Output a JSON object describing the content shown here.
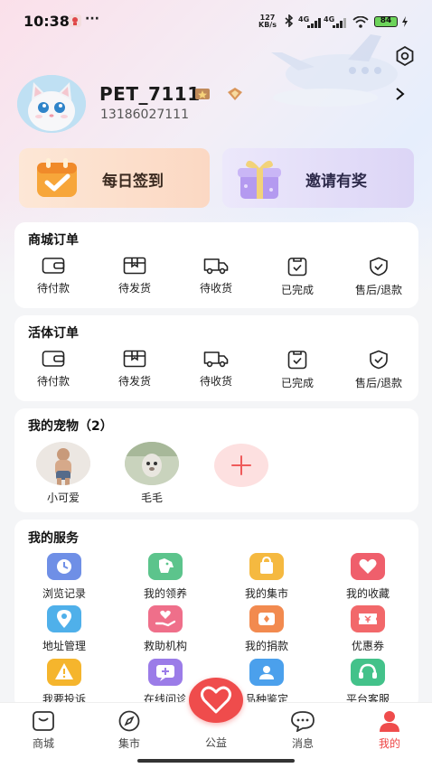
{
  "status_bar": {
    "time": "10:38",
    "overflow": "···",
    "net_speed_value": "127",
    "net_speed_unit": "KB/s",
    "signal1": "4G",
    "signal2": "4G",
    "battery": "84"
  },
  "profile": {
    "username": "PET_7111",
    "phone": "13186027111"
  },
  "promos": {
    "sign_in": "每日签到",
    "invite": "邀请有奖"
  },
  "mall_orders": {
    "title": "商城订单",
    "items": [
      {
        "label": "待付款",
        "icon": "wallet-icon"
      },
      {
        "label": "待发货",
        "icon": "box-icon"
      },
      {
        "label": "待收货",
        "icon": "truck-icon"
      },
      {
        "label": "已完成",
        "icon": "clipboard-check-icon"
      },
      {
        "label": "售后/退款",
        "icon": "shield-check-icon"
      }
    ]
  },
  "live_orders": {
    "title": "活体订单",
    "items": [
      {
        "label": "待付款",
        "icon": "wallet-icon"
      },
      {
        "label": "待发货",
        "icon": "box-icon"
      },
      {
        "label": "待收货",
        "icon": "truck-icon"
      },
      {
        "label": "已完成",
        "icon": "clipboard-check-icon"
      },
      {
        "label": "售后/退款",
        "icon": "shield-check-icon"
      }
    ]
  },
  "pets": {
    "title": "我的宠物（2）",
    "items": [
      {
        "name": "小可爱"
      },
      {
        "name": "毛毛"
      }
    ]
  },
  "services": {
    "title": "我的服务",
    "items": [
      {
        "label": "浏览记录",
        "icon": "clock-icon",
        "color": "#6f8fe6"
      },
      {
        "label": "我的领养",
        "icon": "dog-icon",
        "color": "#5cc48c"
      },
      {
        "label": "我的集市",
        "icon": "shopping-bag-icon",
        "color": "#f5b940"
      },
      {
        "label": "我的收藏",
        "icon": "heart-icon",
        "color": "#ef5f6c"
      },
      {
        "label": "地址管理",
        "icon": "location-pin-icon",
        "color": "#4fb0ea"
      },
      {
        "label": "救助机构",
        "icon": "hand-heart-icon",
        "color": "#ef6f8a"
      },
      {
        "label": "我的捐款",
        "icon": "donation-icon",
        "color": "#f28a4f"
      },
      {
        "label": "优惠券",
        "icon": "coupon-icon",
        "color": "#f2686a"
      },
      {
        "label": "我要投诉",
        "icon": "warning-icon",
        "color": "#f5b52d"
      },
      {
        "label": "在线问诊",
        "icon": "medical-chat-icon",
        "color": "#9b7ce8"
      },
      {
        "label": "品种鉴定",
        "icon": "id-badge-icon",
        "color": "#4ba0ec"
      },
      {
        "label": "平台客服",
        "icon": "headset-icon",
        "color": "#43c28a"
      }
    ]
  },
  "bottom_nav": {
    "items": [
      {
        "label": "商城",
        "icon": "shopping-bag-outline-icon"
      },
      {
        "label": "集市",
        "icon": "compass-icon"
      },
      {
        "label": "公益",
        "icon": "heart-fab-icon"
      },
      {
        "label": "消息",
        "icon": "chat-bubble-icon"
      },
      {
        "label": "我的",
        "icon": "user-icon"
      }
    ],
    "active": "我的",
    "accent": "#ef4c4c"
  }
}
